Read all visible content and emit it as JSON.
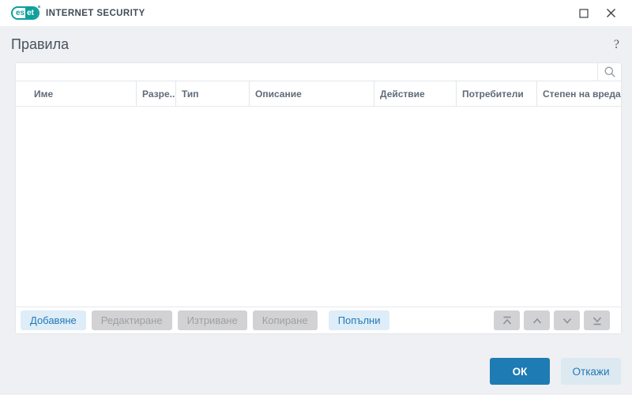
{
  "titlebar": {
    "logo_es": "es",
    "logo_et": "et",
    "brand_text": "INTERNET SECURITY"
  },
  "header": {
    "title": "Правила",
    "help_label": "?"
  },
  "search": {
    "value": "",
    "placeholder": ""
  },
  "table": {
    "columns": [
      {
        "label": "Име"
      },
      {
        "label": "Разре..."
      },
      {
        "label": "Тип"
      },
      {
        "label": "Описание"
      },
      {
        "label": "Действие"
      },
      {
        "label": "Потребители"
      },
      {
        "label": "Степен на вреда"
      }
    ],
    "rows": []
  },
  "toolbar": {
    "add": "Добавяне",
    "edit": "Редактиране",
    "delete": "Изтриване",
    "copy": "Копиране",
    "fill": "Попълни"
  },
  "move_buttons": {
    "top_icon": "chevron-up-with-bar",
    "up_icon": "chevron-up",
    "down_icon": "chevron-down",
    "bottom_icon": "chevron-down-with-bar"
  },
  "footer": {
    "ok": "ОК",
    "cancel": "Откажи"
  },
  "icons": {
    "maximize": "square-outline",
    "close": "x-mark",
    "help": "question-mark",
    "search": "magnifier"
  },
  "colors": {
    "brand_teal": "#0fa09b",
    "accent_blue": "#1e7bb4",
    "soft_button_bg": "#deedf8",
    "soft_button_text": "#2279b5",
    "disabled_bg": "#d2d2d4",
    "disabled_text": "#9da0a3",
    "page_bg": "#eef0f3",
    "title_text": "#47525e",
    "table_header_text": "#5f6b78",
    "border": "#e3e6e9"
  }
}
